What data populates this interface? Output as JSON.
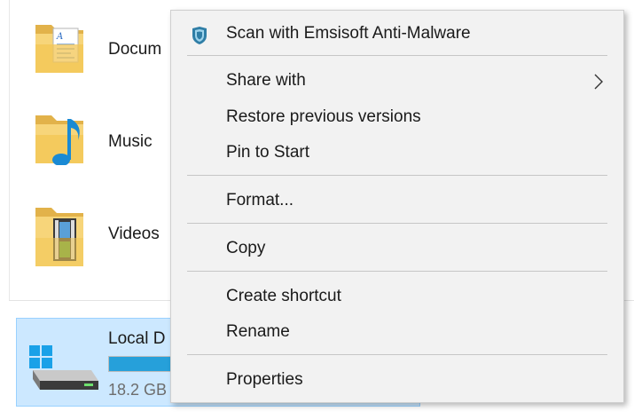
{
  "folders": [
    {
      "label": "Docum",
      "icon": "documents-folder-icon"
    },
    {
      "label": "Music",
      "icon": "music-folder-icon"
    },
    {
      "label": "Videos",
      "icon": "videos-folder-icon"
    }
  ],
  "drive": {
    "label": "Local D",
    "free_text": "18.2 GB",
    "used_fraction": 0.9,
    "icon": "local-disk-icon"
  },
  "context_menu": {
    "items": [
      {
        "label": "Scan with Emsisoft Anti-Malware",
        "icon": "emsisoft-shield-icon"
      },
      {
        "label": "Share with",
        "icon": "chevron-right-icon"
      },
      {
        "label": "Restore previous versions"
      },
      {
        "label": "Pin to Start"
      },
      {
        "label": "Format..."
      },
      {
        "label": "Copy"
      },
      {
        "label": "Create shortcut"
      },
      {
        "label": "Rename"
      },
      {
        "label": "Properties"
      }
    ]
  },
  "colors": {
    "selection_bg": "#cce8ff",
    "selection_border": "#99d1ff",
    "drive_bar": "#26a0da",
    "menu_bg": "#f2f2f2",
    "shield": "#2f7ea6"
  }
}
